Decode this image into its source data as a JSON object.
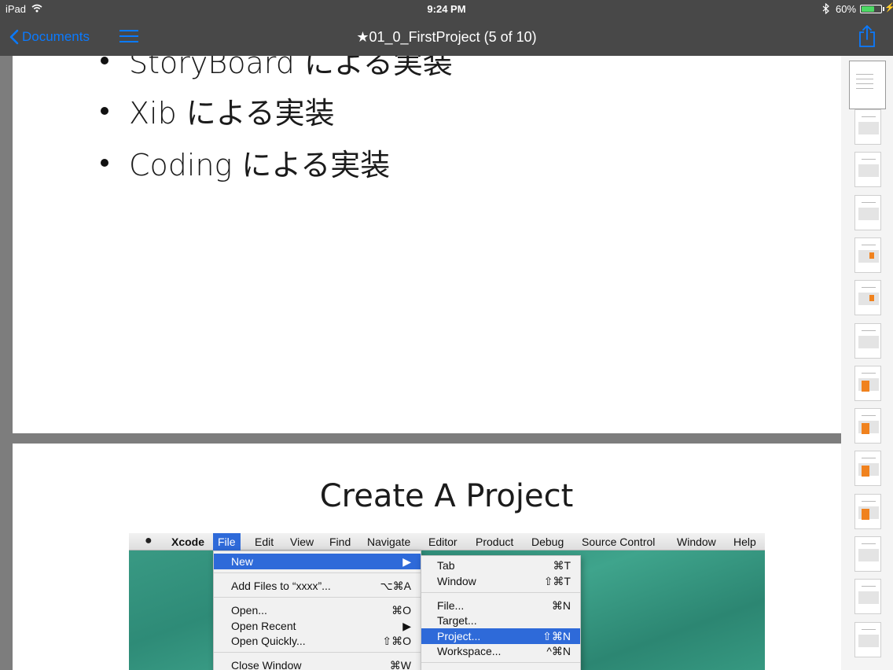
{
  "status_bar": {
    "device": "iPad",
    "time": "9:24 PM",
    "battery_percent": "60%",
    "battery_level": 0.6
  },
  "nav": {
    "back_label": "Documents",
    "title": "★01_0_FirstProject (5 of 10)"
  },
  "colors": {
    "tint": "#0a7aff",
    "bar": "#484848",
    "menu_highlight": "#2e6ad9",
    "thumb_accent": "#f0821e"
  },
  "icons": [
    "wifi-icon",
    "bluetooth-icon",
    "battery-icon",
    "chevron-left-icon",
    "list-icon",
    "share-icon",
    "apple-logo-icon"
  ],
  "page1": {
    "bullets": [
      "StoryBoard による実装",
      "Xib による実装",
      "Coding による実装"
    ]
  },
  "page2": {
    "title": "Create A Project",
    "menubar": [
      "Xcode",
      "File",
      "Edit",
      "View",
      "Find",
      "Navigate",
      "Editor",
      "Product",
      "Debug",
      "Source Control",
      "Window",
      "Help"
    ],
    "file_menu": [
      {
        "label": "New",
        "shortcut": "▶"
      },
      {
        "label": "Add Files to “xxxx”...",
        "shortcut": "⌥⌘A"
      },
      {
        "label": "Open...",
        "shortcut": "⌘O"
      },
      {
        "label": "Open Recent",
        "shortcut": "▶"
      },
      {
        "label": "Open Quickly...",
        "shortcut": "⇧⌘O"
      },
      {
        "label": "Close Window",
        "shortcut": "⌘W"
      }
    ],
    "new_menu": [
      {
        "label": "Tab",
        "shortcut": "⌘T"
      },
      {
        "label": "Window",
        "shortcut": "⇧⌘T"
      },
      {
        "label": "File...",
        "shortcut": "⌘N"
      },
      {
        "label": "Target...",
        "shortcut": ""
      },
      {
        "label": "Project...",
        "shortcut": "⇧⌘N"
      },
      {
        "label": "Workspace...",
        "shortcut": "^⌘N"
      }
    ]
  },
  "thumbnails": {
    "count": 14,
    "current_index": 0
  }
}
